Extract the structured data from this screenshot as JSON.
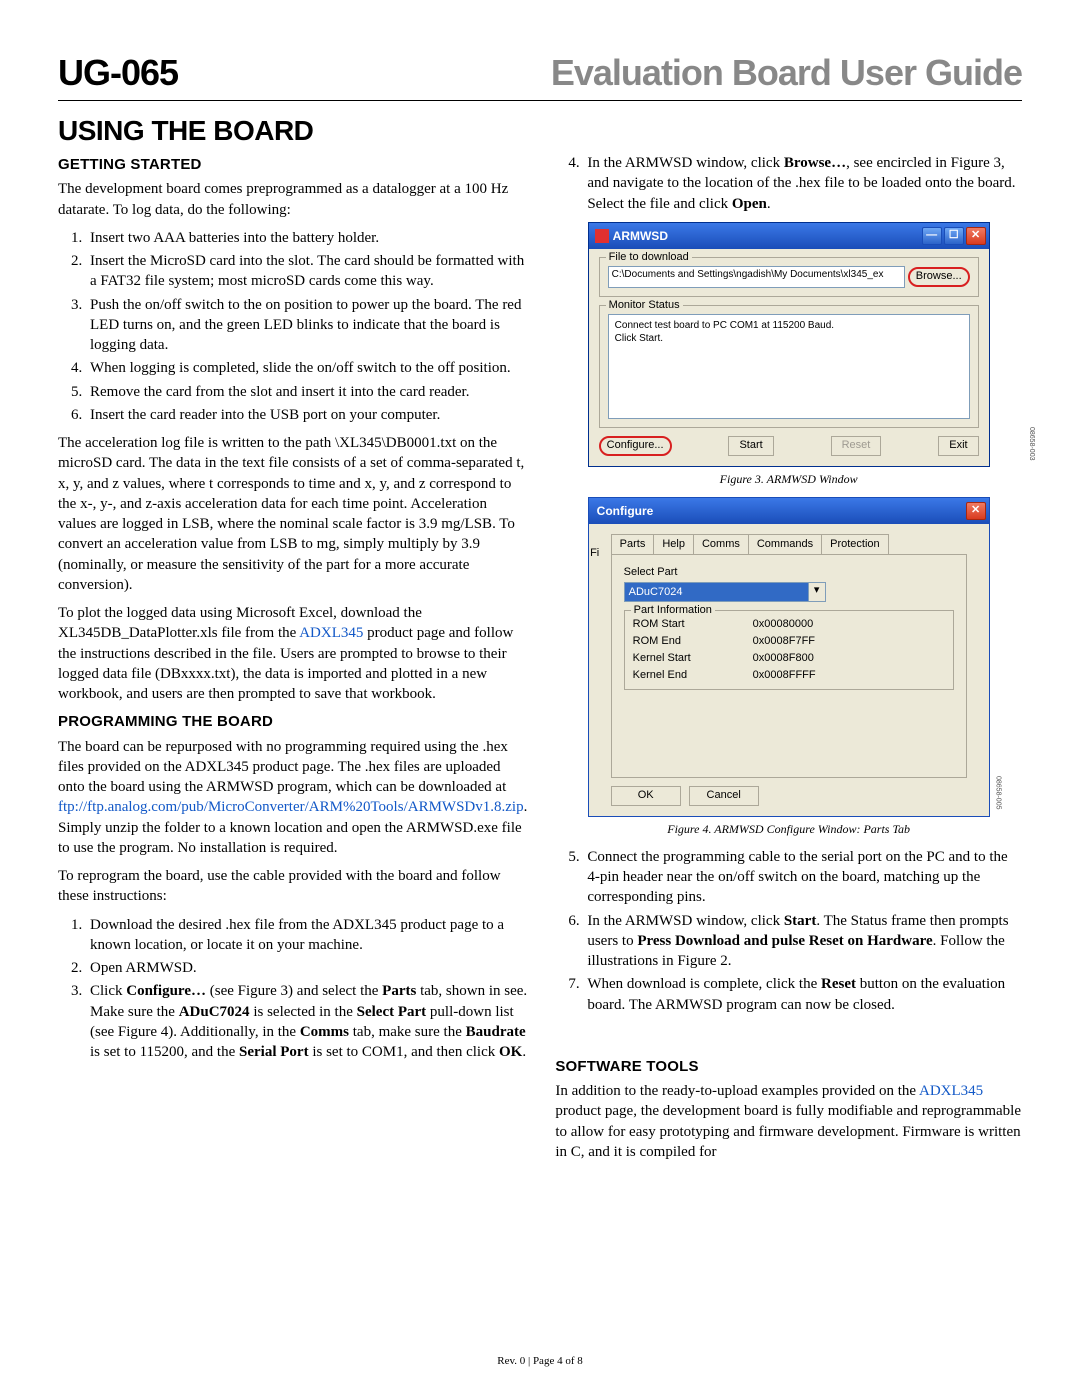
{
  "header": {
    "doc_id": "UG-065",
    "doc_title": "Evaluation Board User Guide"
  },
  "section_title": "USING THE BOARD",
  "left": {
    "sub1": "GETTING STARTED",
    "p1": "The development board comes preprogrammed as a datalogger at a 100 Hz datarate. To log data, do the following:",
    "list1": [
      "Insert two AAA batteries into the battery holder.",
      "Insert the MicroSD card into the slot. The card should be formatted with a FAT32 file system; most microSD cards come this way.",
      "Push the on/off switch to the on position to power up the board. The red LED turns on, and the green LED blinks to indicate that the board is logging data.",
      "When logging is completed, slide the on/off switch to the off position.",
      "Remove the card from the slot and insert it into the card reader.",
      "Insert the card reader into the USB port on your computer."
    ],
    "p2": "The acceleration log file is written to the path \\XL345\\DB0001.txt on the microSD card. The data in the text file consists of a set of comma-separated t, x, y, and z values, where t corresponds to time and x, y, and z correspond to the x-, y-, and z-axis acceleration data for each time point. Acceleration values are logged in LSB, where the nominal scale factor is 3.9 mg/LSB. To convert an acceleration value from LSB to mg, simply multiply by 3.9 (nominally, or measure the sensitivity of the part for a more accurate conversion).",
    "p3_a": "To plot the logged data using Microsoft Excel, download the XL345DB_DataPlotter.xls file from the ",
    "p3_link": "ADXL345",
    "p3_b": " product page and follow the instructions described in the file. Users are prompted to browse to their logged data file (DBxxxx.txt), the data is imported and plotted in a new workbook, and users are then prompted to save that workbook.",
    "sub2": "PROGRAMMING THE BOARD",
    "p4_a": "The board can be repurposed with no programming required using the .hex files provided on the ADXL345 product page. The .hex files are uploaded onto the board using the ARMWSD program, which can be downloaded at ",
    "p4_link": "ftp://ftp.analog.com/pub/MicroConverter/ARM%20Tools/ARMWSDv1.8.zip",
    "p4_b": ". Simply unzip the folder to a known location and open the ARMWSD.exe file to use the program. No installation is required.",
    "p5": "To reprogram the board, use the cable provided with the board and follow these instructions:",
    "list2_1": "Download the desired .hex file from the ADXL345 product page to a known location, or locate it on your machine.",
    "list2_2": "Open ARMWSD.",
    "list2_3": "Click <b>Configure…</b> (see Figure 3) and select the <b>Parts</b> tab, shown in see. Make sure the <b>ADuC7024</b> is selected in the <b>Select Part</b> pull-down list (see Figure 4). Additionally, in the <b>Comms</b> tab, make sure the <b>Baudrate</b> is set to 115200, and the <b>Serial Port</b> is set to COM1, and then click <b>OK</b>."
  },
  "right": {
    "list2_4": "In the ARMWSD window, click <b>Browse…</b>, see encircled in Figure 3, and navigate to the location of the .hex file to be loaded onto the board. Select the file and click <b>Open</b>.",
    "fig3": {
      "title": "ARMWSD",
      "group1": "File to download",
      "file_path": "C:\\Documents and Settings\\ngadish\\My Documents\\xl345_ex",
      "browse": "Browse...",
      "group2": "Monitor Status",
      "status": "Connect test board to PC COM1 at 115200 Baud.\nClick Start.",
      "btn_configure": "Configure...",
      "btn_start": "Start",
      "btn_reset": "Reset",
      "btn_exit": "Exit",
      "side": "08658-003",
      "caption": "Figure 3. ARMWSD Window"
    },
    "fig4": {
      "title": "Configure",
      "tabs": [
        "Parts",
        "Help",
        "Comms",
        "Commands",
        "Protection"
      ],
      "select_label": "Select Part",
      "select_value": "ADuC7024",
      "info_label": "Part Information",
      "rows": [
        [
          "ROM Start",
          "0x00080000"
        ],
        [
          "ROM End",
          "0x0008F7FF"
        ],
        [
          "Kernel Start",
          "0x0008F800"
        ],
        [
          "Kernel End",
          "0x0008FFFF"
        ]
      ],
      "btn_ok": "OK",
      "btn_cancel": "Cancel",
      "side": "08658-005",
      "caption": "Figure 4. ARMWSD Configure Window: Parts Tab",
      "stub_f": "Fi"
    },
    "list2_5": "Connect the programming cable to the serial port on the PC and to the 4-pin header near the on/off switch on the board, matching up the corresponding pins.",
    "list2_6": "In the ARMWSD window, click <b>Start</b>. The Status frame then prompts users to <b>Press Download and pulse Reset on Hardware</b>. Follow the illustrations in Figure 2.",
    "list2_7": "When download is complete, click the <b>Reset</b> button on the evaluation board. The ARMWSD program can now be closed.",
    "sub3": "SOFTWARE TOOLS",
    "p6_a": "In addition to the ready-to-upload examples provided on the ",
    "p6_link": "ADXL345",
    "p6_b": " product page, the development board is fully modifiable and reprogrammable to allow for easy prototyping and firmware development. Firmware is written in C, and it is compiled for"
  },
  "footer": "Rev. 0 | Page 4 of 8"
}
